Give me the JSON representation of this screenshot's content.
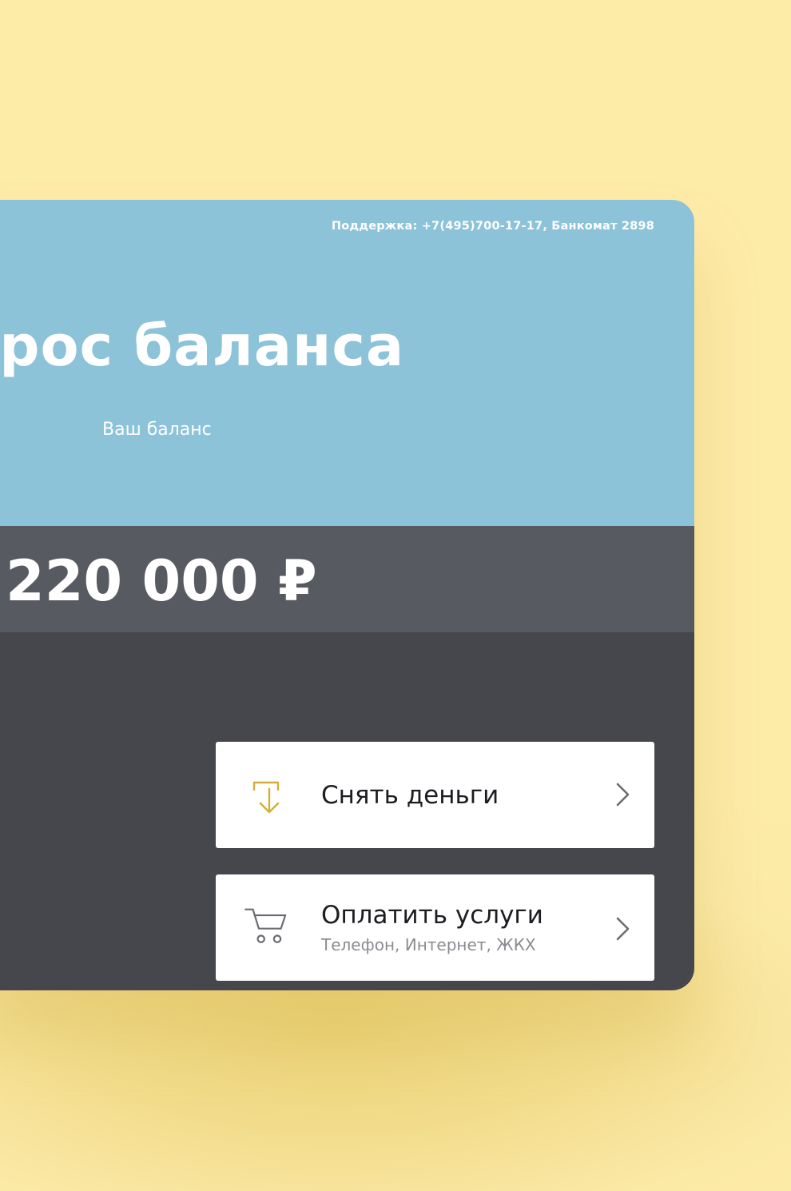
{
  "header": {
    "support_text": "Поддержка: +7(495)700-17-17, Банкомат 2898",
    "title": "прос баланса",
    "balance_label": "Ваш баланс"
  },
  "balance": {
    "amount": "220 000 ₽"
  },
  "actions": [
    {
      "title": "Снять деньги",
      "subtitle": "",
      "icon": "download-tray-icon",
      "icon_color": "#d4ae3a"
    },
    {
      "title": "Оплатить услуги",
      "subtitle": "Телефон, Интернет, ЖКХ",
      "icon": "cart-icon",
      "icon_color": "#6a6c72"
    }
  ],
  "colors": {
    "background": "#fdeba8",
    "header_blue": "#8cc3d9",
    "balance_band": "#585a61",
    "panel_dark": "#45474d",
    "card": "#ffffff"
  }
}
